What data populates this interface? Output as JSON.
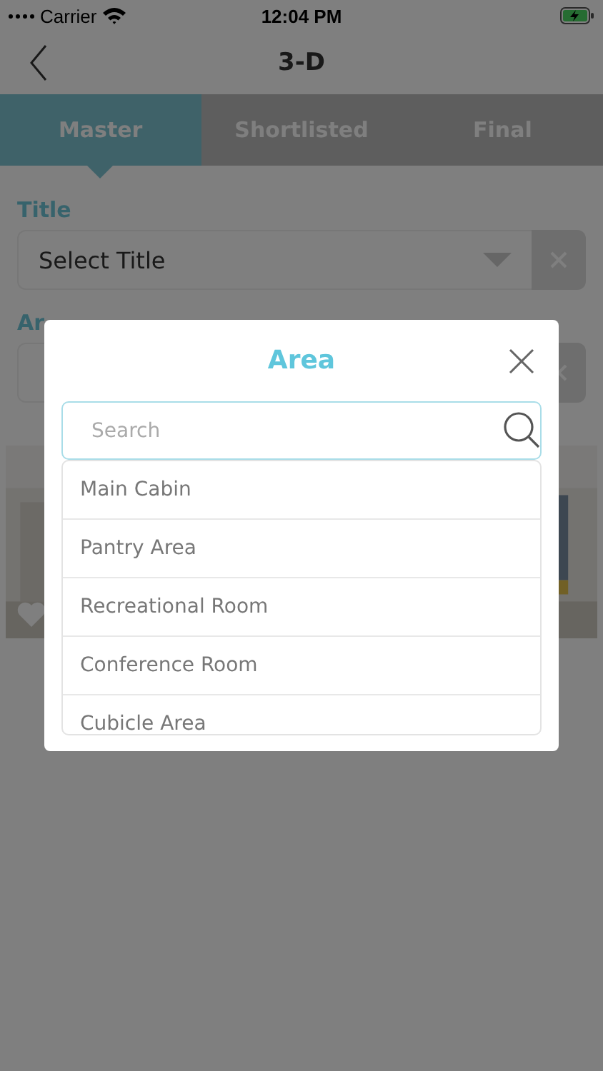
{
  "status_bar": {
    "carrier": "Carrier",
    "time": "12:04 PM"
  },
  "nav": {
    "title": "3-D"
  },
  "tabs": [
    {
      "label": "Master",
      "selected": true
    },
    {
      "label": "Shortlisted",
      "selected": false
    },
    {
      "label": "Final",
      "selected": false
    }
  ],
  "form": [
    {
      "label": "Title",
      "value": "Select Title"
    },
    {
      "label": "Ar"
    }
  ],
  "dialog": {
    "title": "Area",
    "search": {
      "placeholder": "Search"
    },
    "options": [
      {
        "label": "Main Cabin"
      },
      {
        "label": "Pantry Area"
      },
      {
        "label": "Recreational Room"
      },
      {
        "label": "Conference Room"
      },
      {
        "label": "Cubicle Area"
      }
    ]
  }
}
